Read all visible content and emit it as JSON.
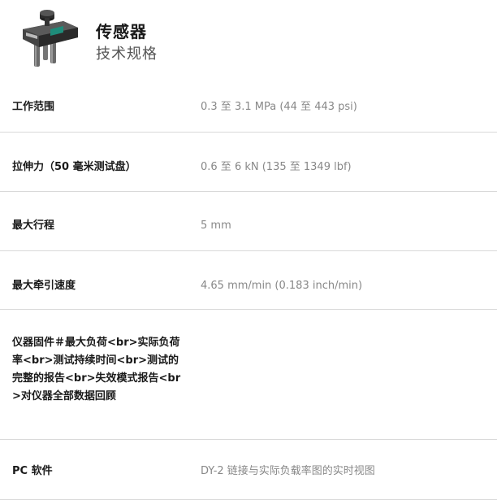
{
  "header": {
    "title": "传感器",
    "subtitle": "技术规格",
    "product_image": "force-gauge-sensor-image"
  },
  "specs": [
    {
      "label": "工作范围",
      "value": "0.3 至 3.1 MPa (44 至 443 psi)"
    },
    {
      "label": "拉伸力（50 毫米测试盘）",
      "value": "0.6 至 6 kN  (135 至 1349 lbf)"
    },
    {
      "label": "最大行程",
      "value": "5 mm"
    },
    {
      "label": "最大牵引速度",
      "value": "4.65 mm/min (0.183 inch/min)"
    },
    {
      "label": "仪器固件＃最大负荷<br>实际负荷率<br>测试持续时间<br>测试的完整的报告<br>失效模式报告<br>对仪器全部数据回顾",
      "value": ""
    },
    {
      "label": "PC 软件",
      "value": "DY-2 链接与实际负载率图的实时视图"
    }
  ]
}
